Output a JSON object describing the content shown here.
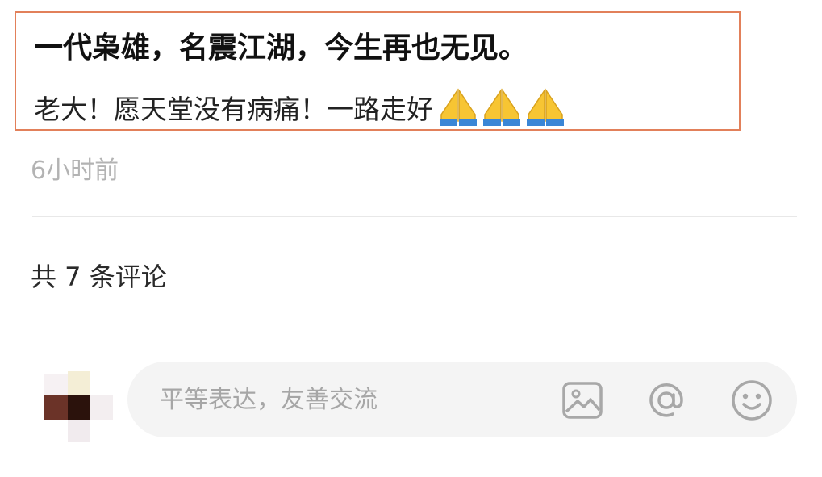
{
  "post": {
    "title": "一代枭雄，名震江湖，今生再也无见。",
    "body": "老大！愿天堂没有病痛！一路走好",
    "emojis": [
      "folded-hands-icon",
      "folded-hands-icon",
      "folded-hands-icon"
    ],
    "highlight_color": "#e2805a"
  },
  "meta": {
    "timestamp": "6小时前"
  },
  "comments": {
    "count_label": "共 7 条评论"
  },
  "comment_bar": {
    "placeholder": "平等表达，友善交流",
    "icons": [
      "image-icon",
      "at-icon",
      "smiley-icon"
    ]
  }
}
